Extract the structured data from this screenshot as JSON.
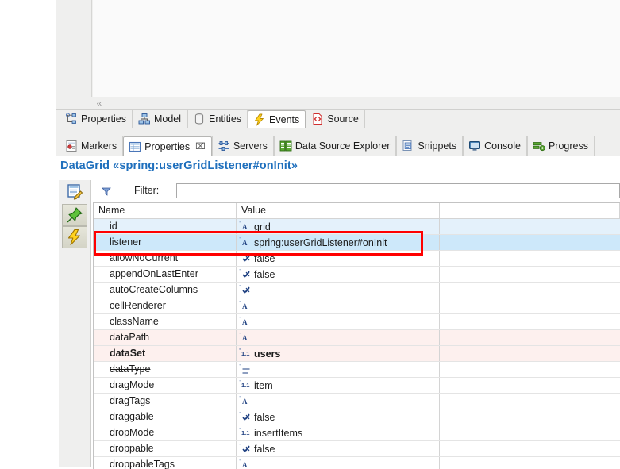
{
  "window": {
    "editor_collapse_glyph": "«"
  },
  "editor_tabs": {
    "items": [
      {
        "label": "Properties",
        "icon": "properties-diagram-icon",
        "active": false
      },
      {
        "label": "Model",
        "icon": "model-tree-icon",
        "active": false
      },
      {
        "label": "Entities",
        "icon": "entities-database-icon",
        "active": false
      },
      {
        "label": "Events",
        "icon": "events-lightning-icon",
        "active": true
      },
      {
        "label": "Source",
        "icon": "source-code-icon",
        "active": false
      }
    ]
  },
  "view_tabs": {
    "items": [
      {
        "label": "Markers",
        "icon": "markers-icon",
        "active": false,
        "closable": false
      },
      {
        "label": "Properties",
        "icon": "properties-view-icon",
        "active": true,
        "closable": true,
        "close_glyph": "⌧"
      },
      {
        "label": "Servers",
        "icon": "servers-icon",
        "active": false,
        "closable": false
      },
      {
        "label": "Data Source Explorer",
        "icon": "data-source-explorer-icon",
        "active": false,
        "closable": false
      },
      {
        "label": "Snippets",
        "icon": "snippets-icon",
        "active": false,
        "closable": false
      },
      {
        "label": "Console",
        "icon": "console-icon",
        "active": false,
        "closable": false
      },
      {
        "label": "Progress",
        "icon": "progress-icon",
        "active": false,
        "closable": false
      }
    ]
  },
  "properties_view": {
    "title": "DataGrid «spring:userGridListener#onInit»",
    "title_color": "#1e6fbd",
    "filter_label": "Filter:",
    "filter_value": "",
    "filter_placeholder": "",
    "toolbar_buttons": [
      {
        "name": "show-advanced-properties-button",
        "icon": "form-edit-icon"
      },
      {
        "name": "pin-properties-button",
        "icon": "green-pin-icon"
      },
      {
        "name": "show-events-button",
        "icon": "yellow-lightning-icon"
      }
    ],
    "table": {
      "columns": [
        "Name",
        "Value"
      ],
      "rows": [
        {
          "name": "id",
          "value": "grid",
          "type_icon": "string-type-icon",
          "state": "selected-light"
        },
        {
          "name": "listener",
          "value": "spring:userGridListener#onInit",
          "type_icon": "string-type-icon",
          "state": "selected-strong"
        },
        {
          "name": "allowNoCurrent",
          "value": "false",
          "type_icon": "boolean-type-icon",
          "state": "normal"
        },
        {
          "name": "appendOnLastEnter",
          "value": "false",
          "type_icon": "boolean-type-icon",
          "state": "normal"
        },
        {
          "name": "autoCreateColumns",
          "value": "",
          "type_icon": "boolean-type-icon",
          "state": "normal"
        },
        {
          "name": "cellRenderer",
          "value": "",
          "type_icon": "string-type-icon",
          "state": "normal"
        },
        {
          "name": "className",
          "value": "",
          "type_icon": "string-type-icon",
          "state": "normal"
        },
        {
          "name": "dataPath",
          "value": "",
          "type_icon": "string-type-icon",
          "state": "modified"
        },
        {
          "name": "dataSet",
          "value": "users",
          "type_icon": "enum-type-icon",
          "state": "modified",
          "bold": true
        },
        {
          "name": "dataType",
          "value": "",
          "type_icon": "list-type-icon",
          "state": "normal",
          "strikethrough": true
        },
        {
          "name": "dragMode",
          "value": "item",
          "type_icon": "enum-type-icon",
          "state": "normal"
        },
        {
          "name": "dragTags",
          "value": "",
          "type_icon": "string-type-icon",
          "state": "normal"
        },
        {
          "name": "draggable",
          "value": "false",
          "type_icon": "boolean-type-icon",
          "state": "normal"
        },
        {
          "name": "dropMode",
          "value": "insertItems",
          "type_icon": "enum-type-icon",
          "state": "normal"
        },
        {
          "name": "droppable",
          "value": "false",
          "type_icon": "boolean-type-icon",
          "state": "normal"
        },
        {
          "name": "droppableTags",
          "value": "",
          "type_icon": "string-type-icon",
          "state": "normal"
        }
      ]
    }
  },
  "annotation": {
    "shape": "rectangle",
    "color": "#ff0000",
    "target_row": "listener"
  }
}
